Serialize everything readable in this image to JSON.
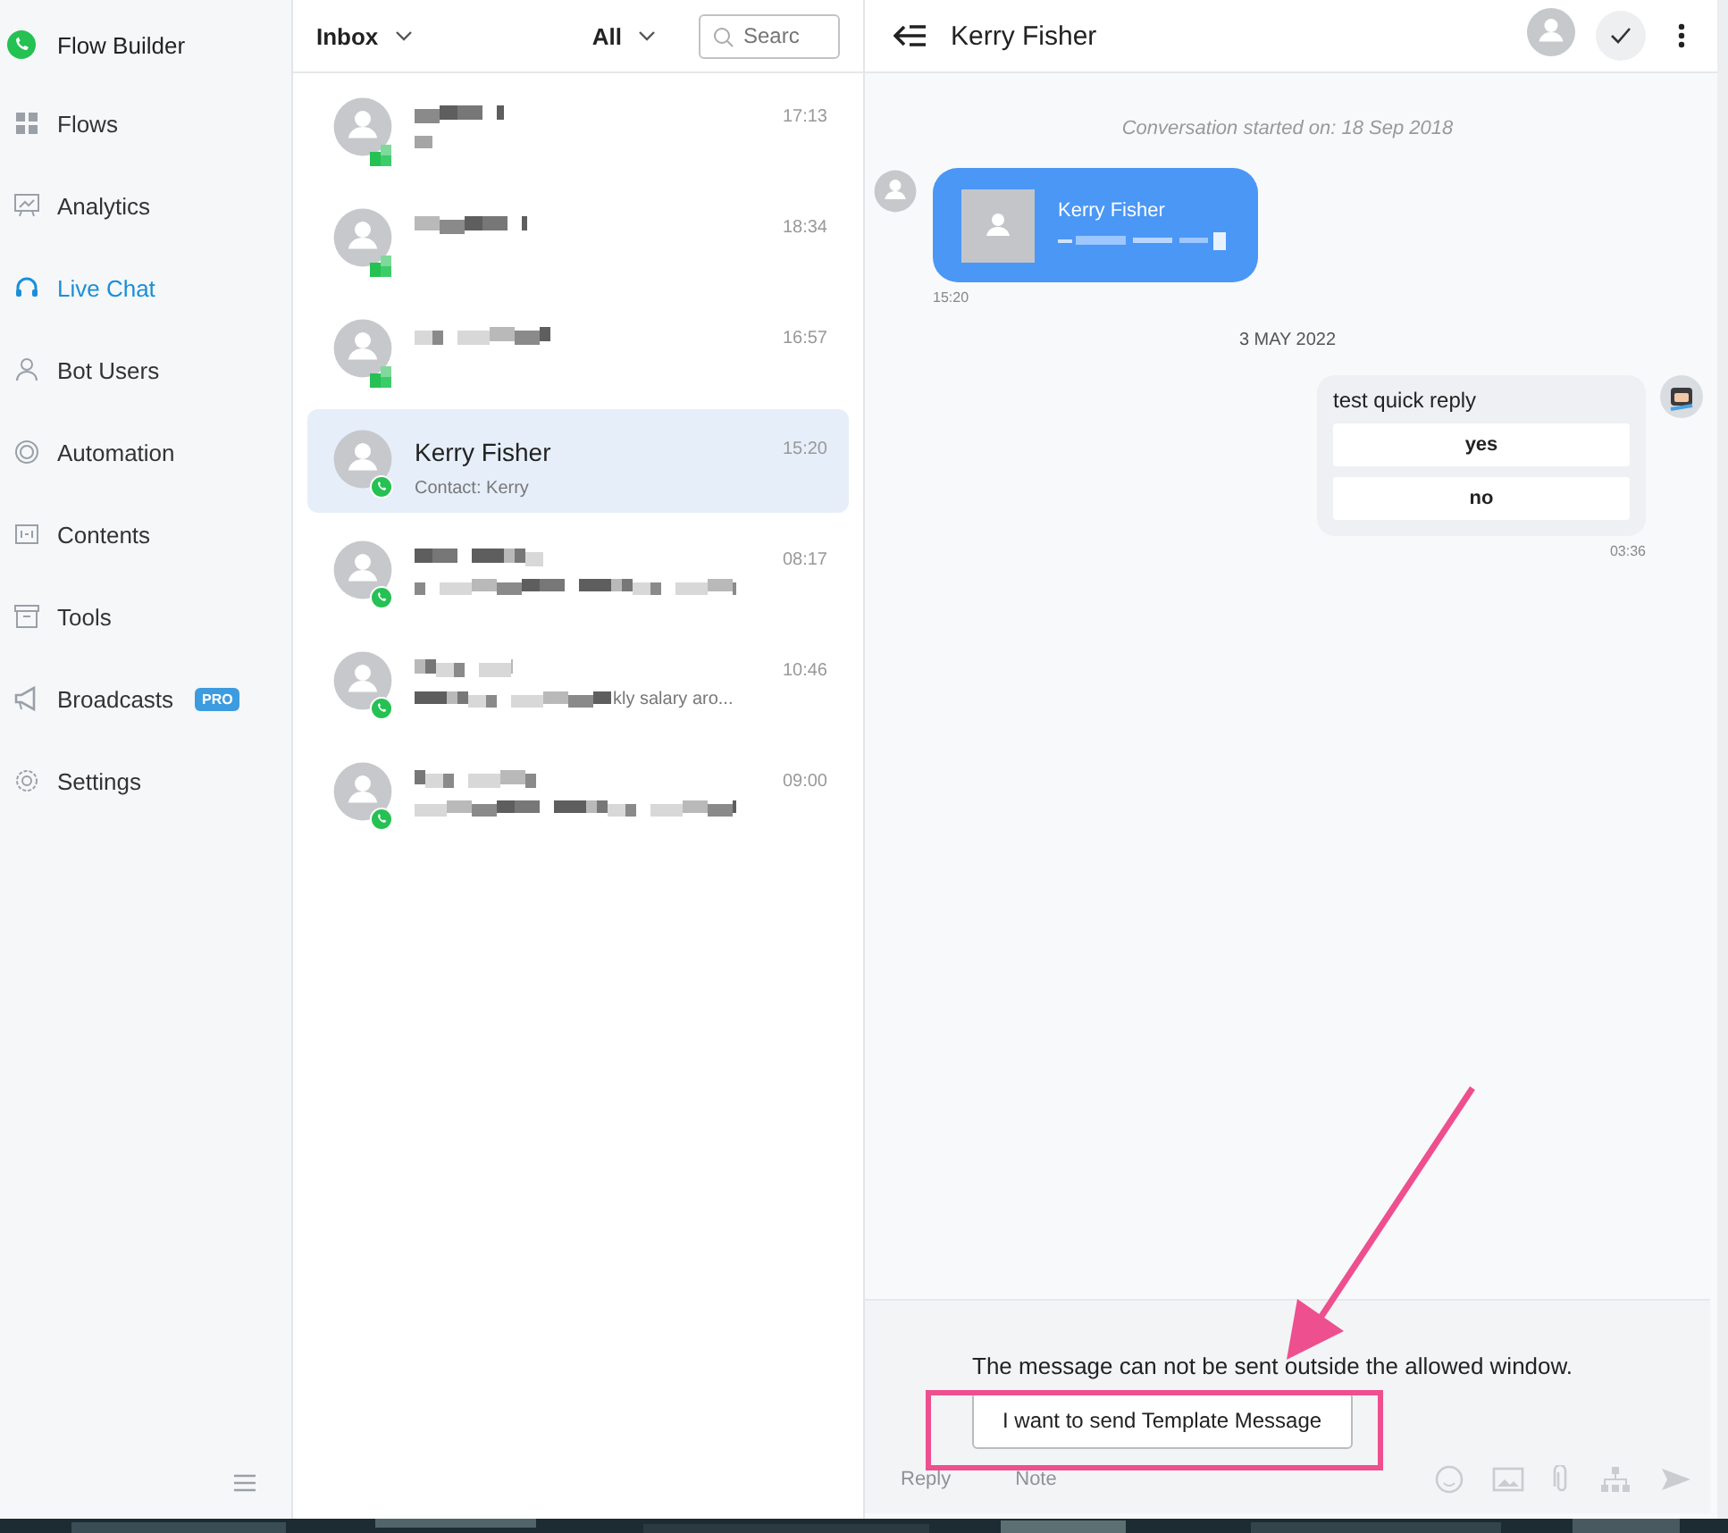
{
  "sidebar": {
    "brand": "Flow Builder",
    "items": [
      {
        "label": "Flows",
        "selected": false
      },
      {
        "label": "Analytics",
        "selected": false
      },
      {
        "label": "Live Chat",
        "selected": true
      },
      {
        "label": "Bot Users",
        "selected": false
      },
      {
        "label": "Automation",
        "selected": false
      },
      {
        "label": "Contents",
        "selected": false
      },
      {
        "label": "Tools",
        "selected": false
      },
      {
        "label": "Broadcasts",
        "selected": false,
        "badge": "PRO"
      },
      {
        "label": "Settings",
        "selected": false
      }
    ]
  },
  "inbox": {
    "folder": "Inbox",
    "filter": "All",
    "search": {
      "placeholder": "Searc"
    },
    "conversations": [
      {
        "time": "17:13",
        "selected": false,
        "kind": "pixel"
      },
      {
        "time": "18:34",
        "selected": false,
        "kind": "pixel"
      },
      {
        "time": "16:57",
        "selected": false,
        "kind": "pixel"
      },
      {
        "name": "Kerry Fisher",
        "preview": "Contact: Kerry",
        "time": "15:20",
        "selected": true,
        "kind": "whatsapp"
      },
      {
        "time": "08:17",
        "selected": false,
        "kind": "whatsapp"
      },
      {
        "preview_tail": "kly salary aro...",
        "time": "10:46",
        "selected": false,
        "kind": "whatsapp"
      },
      {
        "time": "09:00",
        "selected": false,
        "kind": "whatsapp"
      }
    ]
  },
  "chat": {
    "title": "Kerry Fisher",
    "started": "Conversation started on: 18 Sep 2018",
    "messages": [
      {
        "kind": "contact",
        "name": "Kerry Fisher",
        "time": "15:20"
      },
      {
        "kind": "date",
        "text": "3 MAY 2022"
      },
      {
        "kind": "quick_reply",
        "text": "test quick reply",
        "options": [
          "yes",
          "no"
        ],
        "time": "03:36"
      }
    ],
    "notice": "The message can not be sent outside the allowed window.",
    "template_button": "I want to send Template Message",
    "composer_tabs": [
      "Reply",
      "Note"
    ]
  }
}
